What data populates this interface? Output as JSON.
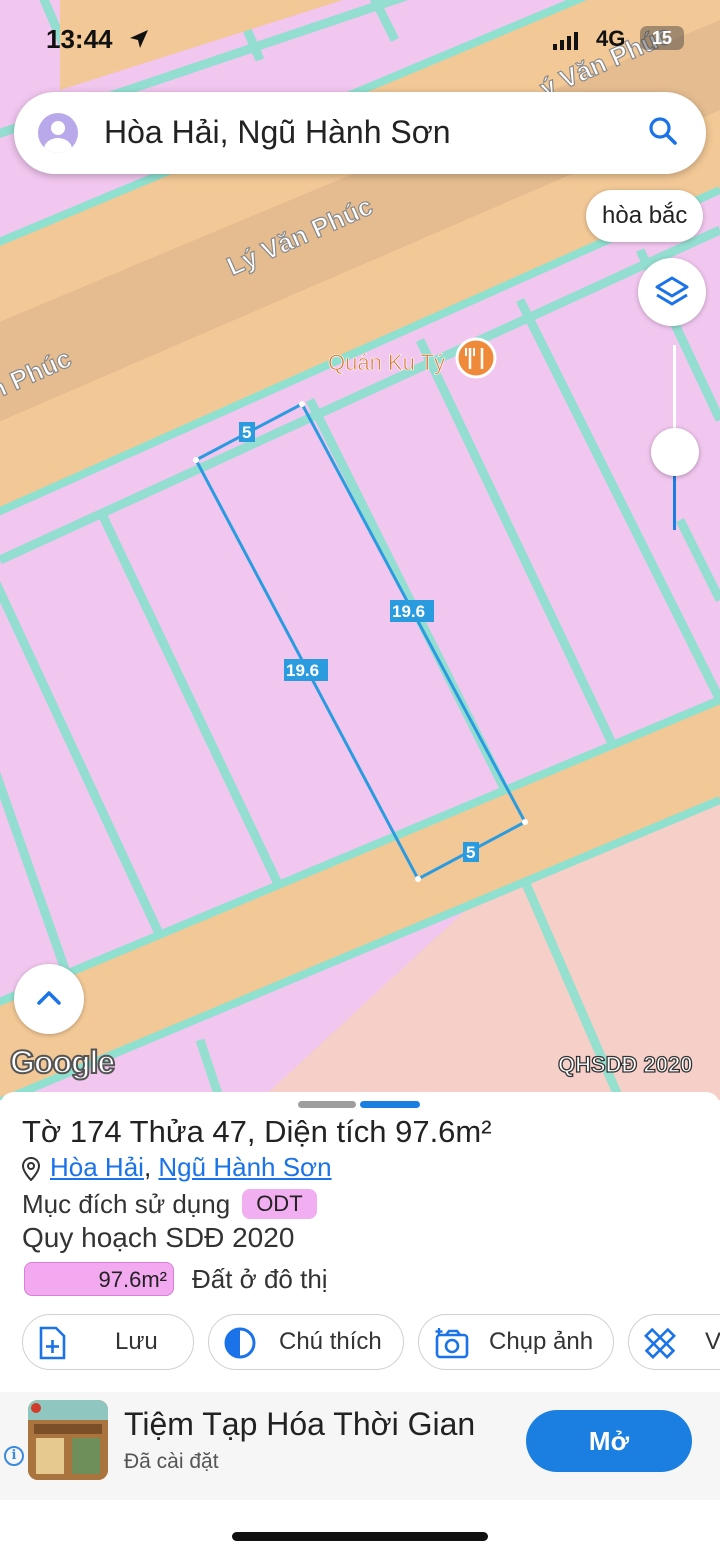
{
  "status_bar": {
    "time": "13:44",
    "network": "4G",
    "battery": "15"
  },
  "search": {
    "query": "Hòa Hải, Ngũ Hành Sơn"
  },
  "map": {
    "street_labels": [
      "Lý Văn Phúc",
      "n Phúc",
      "ý Văn Phúc"
    ],
    "poi": {
      "name": "Quán Ku Tý",
      "icon": "restaurant-icon"
    },
    "parcel_edges": [
      "5",
      "19.6",
      "19.6",
      "5"
    ],
    "chip": "hòa bắc",
    "attribution": "Google",
    "layer_label": "QHSDĐ 2020",
    "zoom_level": 0.45
  },
  "parcel": {
    "title": "Tờ 174 Thửa 47, Diện tích 97.6m²",
    "ward": "Hòa Hải",
    "separator": ",",
    "district": "Ngũ Hành Sơn",
    "purpose_label": "Mục đích sử dụng",
    "purpose_code": "ODT",
    "plan_title": "Quy hoạch SDĐ 2020",
    "plan_area": "97.6m²",
    "plan_land_type": "Đất ở đô thị"
  },
  "actions": [
    {
      "label": "Lưu",
      "icon": "add-document-icon"
    },
    {
      "label": "Chú thích",
      "icon": "contrast-icon"
    },
    {
      "label": "Chụp ảnh",
      "icon": "camera-icon"
    },
    {
      "label": "V",
      "icon": "measure-icon"
    }
  ],
  "ad": {
    "name": "Tiệm Tạp Hóa Thời Gian",
    "subtitle": "Đã cài đặt",
    "button": "Mở",
    "info": "i"
  },
  "colors": {
    "map_land": "#f1c6ef",
    "road": "#f2c896",
    "road_dark": "#d9b28b",
    "lot_line": "#8fe0cf",
    "parcel_outline": "#2b9be0",
    "accent": "#1a7fe0",
    "odt_badge": "#f1aef0"
  }
}
